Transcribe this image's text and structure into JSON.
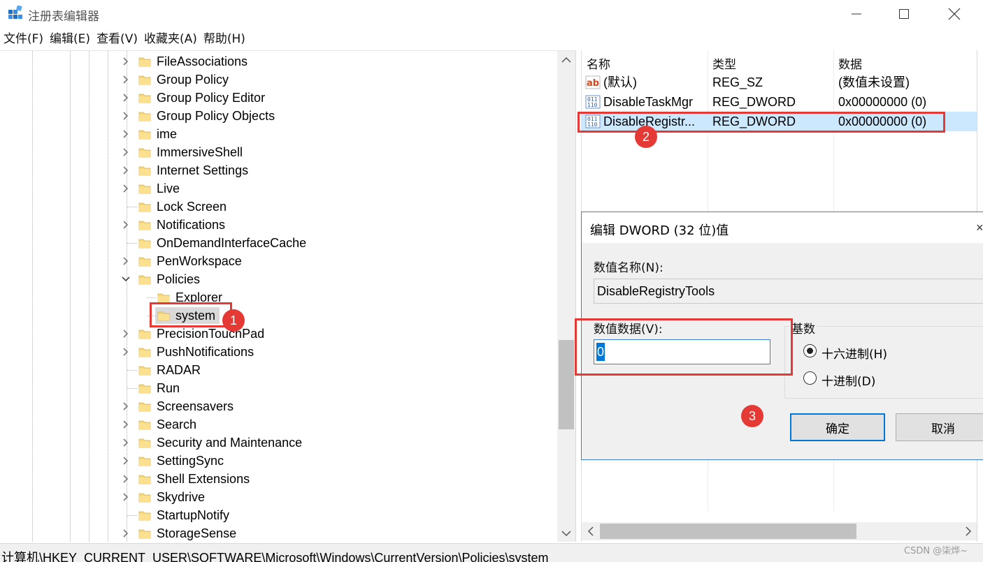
{
  "window": {
    "title": "注册表编辑器",
    "minimize_icon": "minimize-icon",
    "maximize_icon": "maximize-icon",
    "close_icon": "close-icon"
  },
  "menu": [
    "文件(F)",
    "编辑(E)",
    "查看(V)",
    "收藏夹(A)",
    "帮助(H)"
  ],
  "tree": {
    "items": [
      {
        "label": "FileAssociations",
        "expandable": true
      },
      {
        "label": "Group Policy",
        "expandable": true
      },
      {
        "label": "Group Policy Editor",
        "expandable": true
      },
      {
        "label": "Group Policy Objects",
        "expandable": true
      },
      {
        "label": "ime",
        "expandable": true
      },
      {
        "label": "ImmersiveShell",
        "expandable": true
      },
      {
        "label": "Internet Settings",
        "expandable": true
      },
      {
        "label": "Live",
        "expandable": true
      },
      {
        "label": "Lock Screen",
        "expandable": false
      },
      {
        "label": "Notifications",
        "expandable": true
      },
      {
        "label": "OnDemandInterfaceCache",
        "expandable": false
      },
      {
        "label": "PenWorkspace",
        "expandable": true
      },
      {
        "label": "Policies",
        "expandable": true,
        "expanded": true
      },
      {
        "label": "Explorer",
        "expandable": false,
        "child": true
      },
      {
        "label": "system",
        "expandable": false,
        "child": true,
        "selected": true
      },
      {
        "label": "PrecisionTouchPad",
        "expandable": true
      },
      {
        "label": "PushNotifications",
        "expandable": true
      },
      {
        "label": "RADAR",
        "expandable": false
      },
      {
        "label": "Run",
        "expandable": false
      },
      {
        "label": "Screensavers",
        "expandable": true
      },
      {
        "label": "Search",
        "expandable": true
      },
      {
        "label": "Security and Maintenance",
        "expandable": true
      },
      {
        "label": "SettingSync",
        "expandable": true
      },
      {
        "label": "Shell Extensions",
        "expandable": true
      },
      {
        "label": "Skydrive",
        "expandable": true
      },
      {
        "label": "StartupNotify",
        "expandable": false
      },
      {
        "label": "StorageSense",
        "expandable": true
      }
    ]
  },
  "values": {
    "headers": {
      "name": "名称",
      "type": "类型",
      "data": "数据"
    },
    "rows": [
      {
        "name": "(默认)",
        "type": "REG_SZ",
        "data": "(数值未设置)",
        "icon": "string-value-icon"
      },
      {
        "name": "DisableTaskMgr",
        "type": "REG_DWORD",
        "data": "0x00000000 (0)",
        "icon": "dword-value-icon"
      },
      {
        "name": "DisableRegistr...",
        "type": "REG_DWORD",
        "data": "0x00000000 (0)",
        "icon": "dword-value-icon",
        "selected": true
      }
    ]
  },
  "dialog": {
    "title": "编辑 DWORD (32 位)值",
    "value_name_label": "数值名称(N):",
    "value_name": "DisableRegistryTools",
    "value_data_label": "数值数据(V):",
    "value_data": "0",
    "base_label": "基数",
    "hex_label": "十六进制(H)",
    "dec_label": "十进制(D)",
    "selected_base": "hex",
    "ok_label": "确定",
    "cancel_label": "取消"
  },
  "statusbar": {
    "path": "计算机\\HKEY_CURRENT_USER\\SOFTWARE\\Microsoft\\Windows\\CurrentVersion\\Policies\\system"
  },
  "watermark": "CSDN @柒烨~",
  "annotations": {
    "badge_1": "1",
    "badge_2": "2",
    "badge_3": "3",
    "color": "#e53935"
  },
  "colors": {
    "selection_blue": "#cce8ff",
    "accent": "#0078d7",
    "folder": "#f8d775"
  }
}
